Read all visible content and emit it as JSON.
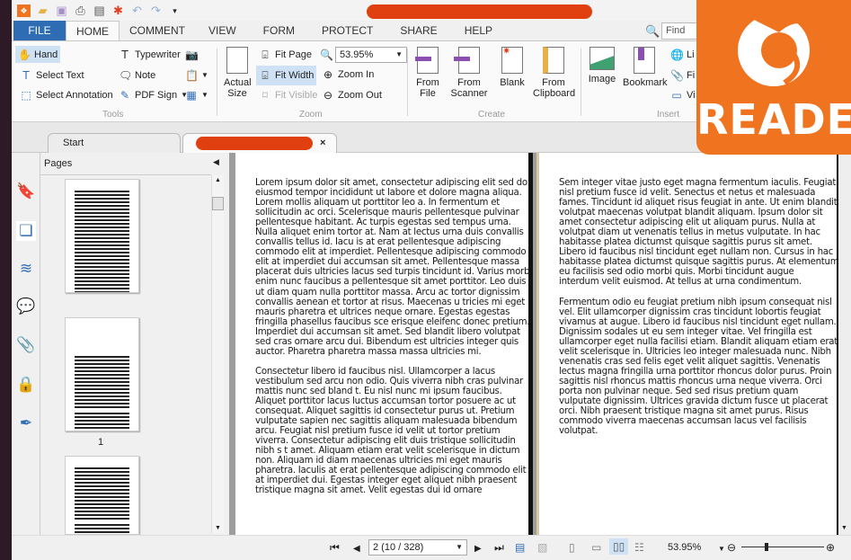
{
  "app": {
    "title_redacted": true,
    "brand_color": "#f07320",
    "accent": "#2e6db4",
    "logo_text": "READER"
  },
  "quick_access": [
    "app-icon",
    "open-icon",
    "save-icon",
    "print-icon",
    "scan-icon",
    "new-icon",
    "undo-icon",
    "redo-icon",
    "customize-icon"
  ],
  "menu": {
    "tabs": [
      "FILE",
      "HOME",
      "COMMENT",
      "VIEW",
      "FORM",
      "PROTECT",
      "SHARE",
      "HELP"
    ],
    "active": "HOME",
    "find_placeholder": "Find"
  },
  "ribbon": {
    "tools": {
      "label": "Tools",
      "hand": "Hand",
      "select_text": "Select Text",
      "select_annotation": "Select Annotation",
      "typewriter": "Typewriter",
      "note": "Note",
      "pdf_sign": "PDF Sign"
    },
    "zoom": {
      "label": "Zoom",
      "actual_size": "Actual Size",
      "fit_page": "Fit Page",
      "fit_width": "Fit Width",
      "fit_visible": "Fit Visible",
      "zoom_value": "53.95%",
      "zoom_in": "Zoom In",
      "zoom_out": "Zoom Out"
    },
    "create": {
      "label": "Create",
      "from_file": "From File",
      "from_scanner": "From Scanner",
      "blank": "Blank",
      "from_clipboard": "From Clipboard"
    },
    "insert": {
      "label": "Insert",
      "image": "Image",
      "bookmark": "Bookmark",
      "link": "Li",
      "file": "Fi",
      "video": "Vi"
    }
  },
  "doc_tabs": {
    "start": "Start",
    "close": "×"
  },
  "pages_panel": {
    "title": "Pages",
    "thumb_label": "1"
  },
  "left_page": {
    "p1": [
      "Lorem ipsum dolor sit amet, consectetur adipiscing elit sed do",
      "eiusmod tempor incididunt ut labore et dolore magna aliqua.",
      "Lorem mollis aliquam ut porttitor leo a. In fermentum et",
      "sollicitudin ac orci. Scelerisque mauris pellentesque pulvinar",
      "pellentesque habitant. Ac turpis egestas sed tempus urna.",
      "Nulla aliquet enim tortor at. Nam at lectus urna duis convallis",
      "convallis tellus id. Iacu is at erat pellentesque adipiscing",
      "commodo elit at imperdiet. Pellentesque adipiscing commodo",
      "elit at imperdiet dui accumsan sit amet. Pellentesque massa",
      "placerat duis ultricies lacus sed turpis tincidunt id. Varius morbi",
      "enim nunc faucibus a pellentesque sit amet porttitor. Leo duis",
      "ut diam quam nulla porttitor massa. Arcu ac tortor dignissim",
      "convallis aenean et tortor at risus. Maecenas u tricies mi eget",
      "mauris pharetra et ultrices neque ornare. Egestas egestas",
      "fringilla phasellus faucibus sce erisque eleifenc donec pretium.",
      "Imperdiet dui accumsan sit amet. Sed blandit libero volutpat",
      "sed cras ornare arcu dui. Bibendum est ultricies integer quis",
      "auctor. Pharetra pharetra massa massa ultricies mi."
    ],
    "p2": [
      "Consectetur libero id faucibus nisl. Ullamcorper a lacus",
      "vestibulum sed arcu non odio. Quis viverra nibh cras pulvinar",
      "mattis nunc sed bland t. Eu nisl nunc mi ipsum faucibus.",
      "Aliquet porttitor lacus luctus accumsan tortor posuere ac ut",
      "consequat. Aliquet sagittis id consectetur purus ut. Pretium",
      "vulputate sapien nec sagittis aliquam malesuada bibendum",
      "arcu. Feugiat nisl pretium fusce id velit ut tortor pretium",
      "viverra. Consectetur adipiscing elit duis tristique sollicitudin",
      "nibh s t amet. Aliquam etiam erat velit scelerisque in dictum",
      "non. Aliquam id diam maecenas ultricies mi eget mauris",
      "pharetra. Iaculis at erat pellentesque adipiscing commodo elit",
      "at imperdiet dui. Egestas integer eget aliquet nibh praesent",
      "tristique magna sit amet. Velit egestas dui id ornare"
    ]
  },
  "right_page": {
    "p1": [
      "Sem integer vitae justo eget magna fermentum iaculis. Feugiat",
      "nisl pretium fusce id velit. Senectus et netus et malesuada",
      "fames. Tincidunt id aliquet risus feugiat in ante. Ut enim blandit",
      "volutpat maecenas volutpat blandit aliquam. Ipsum dolor sit",
      "amet consectetur adipiscing elit ut aliquam purus. Nulla at",
      "volutpat diam ut venenatis tellus in metus vulputate. In hac",
      "habitasse platea dictumst quisque sagittis purus sit amet.",
      "Libero id faucibus nisl tincidunt eget nullam non. Cursus in hac",
      "habitasse platea dictumst quisque sagittis purus. At elementum",
      "eu facilisis sed odio morbi quis. Morbi tincidunt augue",
      "interdum velit euismod. At tellus at urna condimentum."
    ],
    "p2": [
      "Fermentum odio eu feugiat pretium nibh ipsum consequat nisl",
      "vel. Elit ullamcorper dignissim cras tincidunt lobortis feugiat",
      "vivamus at augue. Libero id faucibus nisl tincidunt eget nullam.",
      "Dignissim sodales ut eu sem integer vitae. Vel fringilla est",
      "ullamcorper eget nulla facilisi etiam. Blandit aliquam etiam erat",
      "velit scelerisque in. Ultricies leo integer malesuada nunc. Nibh",
      "venenatis cras sed felis eget velit aliquet sagittis. Venenatis",
      "lectus magna fringilla urna porttitor rhoncus dolor purus. Proin",
      "sagittis nisl rhoncus mattis rhoncus urna neque viverra. Orci",
      "porta non pulvinar neque. Sed sed risus pretium quam",
      "vulputate dignissim. Ultrices gravida dictum fusce ut placerat",
      "orci. Nibh praesent tristique magna sit amet purus. Risus",
      "commodo viverra maecenas accumsan lacus vel facilisis",
      "volutpat."
    ]
  },
  "status": {
    "page_field": "2 (10 / 328)",
    "zoom": "53.95%",
    "zoom_slider_percent": 30,
    "layout_active": "facing"
  }
}
